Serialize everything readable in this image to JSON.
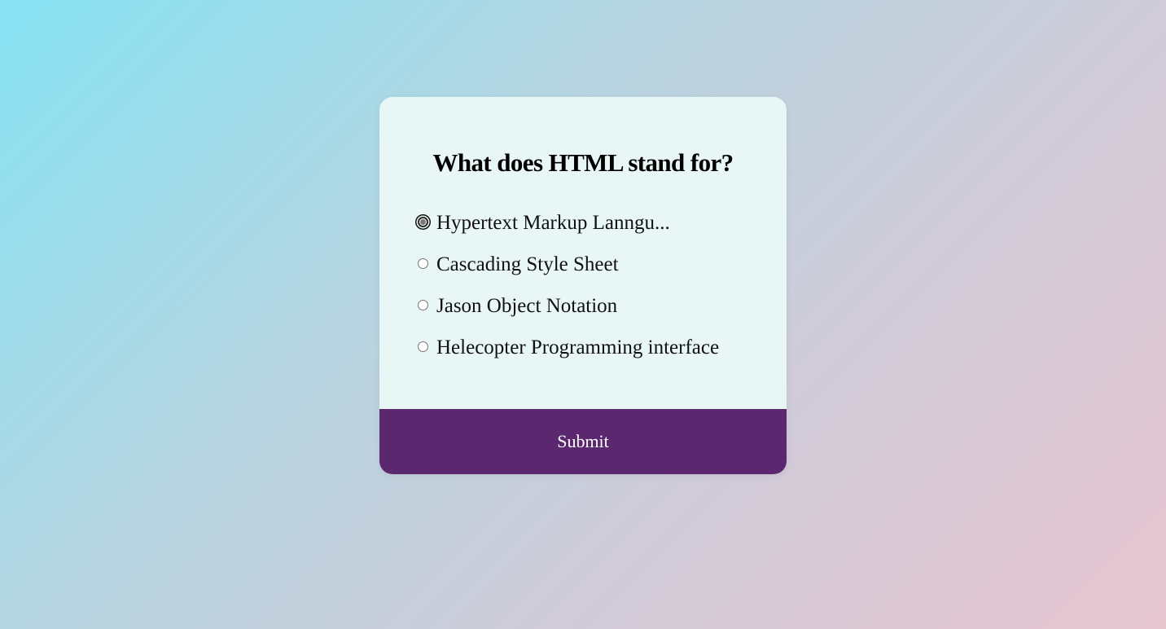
{
  "quiz": {
    "question": "What does HTML stand for?",
    "answers": [
      {
        "label": "Hypertext Markup Lanngu...",
        "selected": true
      },
      {
        "label": "Cascading Style Sheet",
        "selected": false
      },
      {
        "label": "Jason Object Notation",
        "selected": false
      },
      {
        "label": "Helecopter Programming interface",
        "selected": false
      }
    ],
    "submit_label": "Submit"
  },
  "colors": {
    "background_start": "#87e3f3",
    "background_end": "#e6c5cf",
    "card": "#e8f6f6",
    "submit_button": "#5b286f"
  }
}
